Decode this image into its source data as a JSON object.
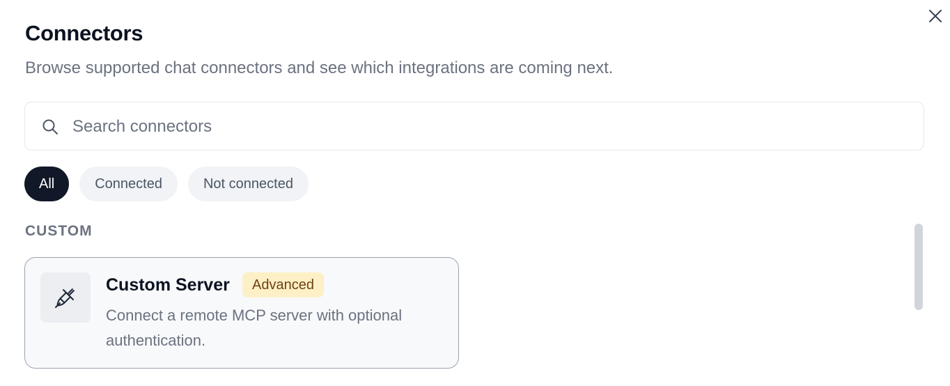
{
  "dialog": {
    "title": "Connectors",
    "subtitle": "Browse supported chat connectors and see which integrations are coming next.",
    "close_icon": "close-icon"
  },
  "search": {
    "placeholder": "Search connectors",
    "value": "",
    "icon": "search-icon"
  },
  "filters": {
    "selected": "All",
    "items": [
      {
        "label": "All",
        "active": true
      },
      {
        "label": "Connected",
        "active": false
      },
      {
        "label": "Not connected",
        "active": false
      }
    ]
  },
  "sections": [
    {
      "label": "CUSTOM",
      "cards": [
        {
          "icon": "plug-icon",
          "title": "Custom Server",
          "badge": "Advanced",
          "description": "Connect a remote MCP server with optional authentication."
        }
      ]
    }
  ],
  "colors": {
    "active_pill": "#111827",
    "pill_bg": "#f1f3f6",
    "badge_bg": "#fdf0c6",
    "badge_text": "#713f12",
    "card_bg": "#f8f9fb"
  }
}
